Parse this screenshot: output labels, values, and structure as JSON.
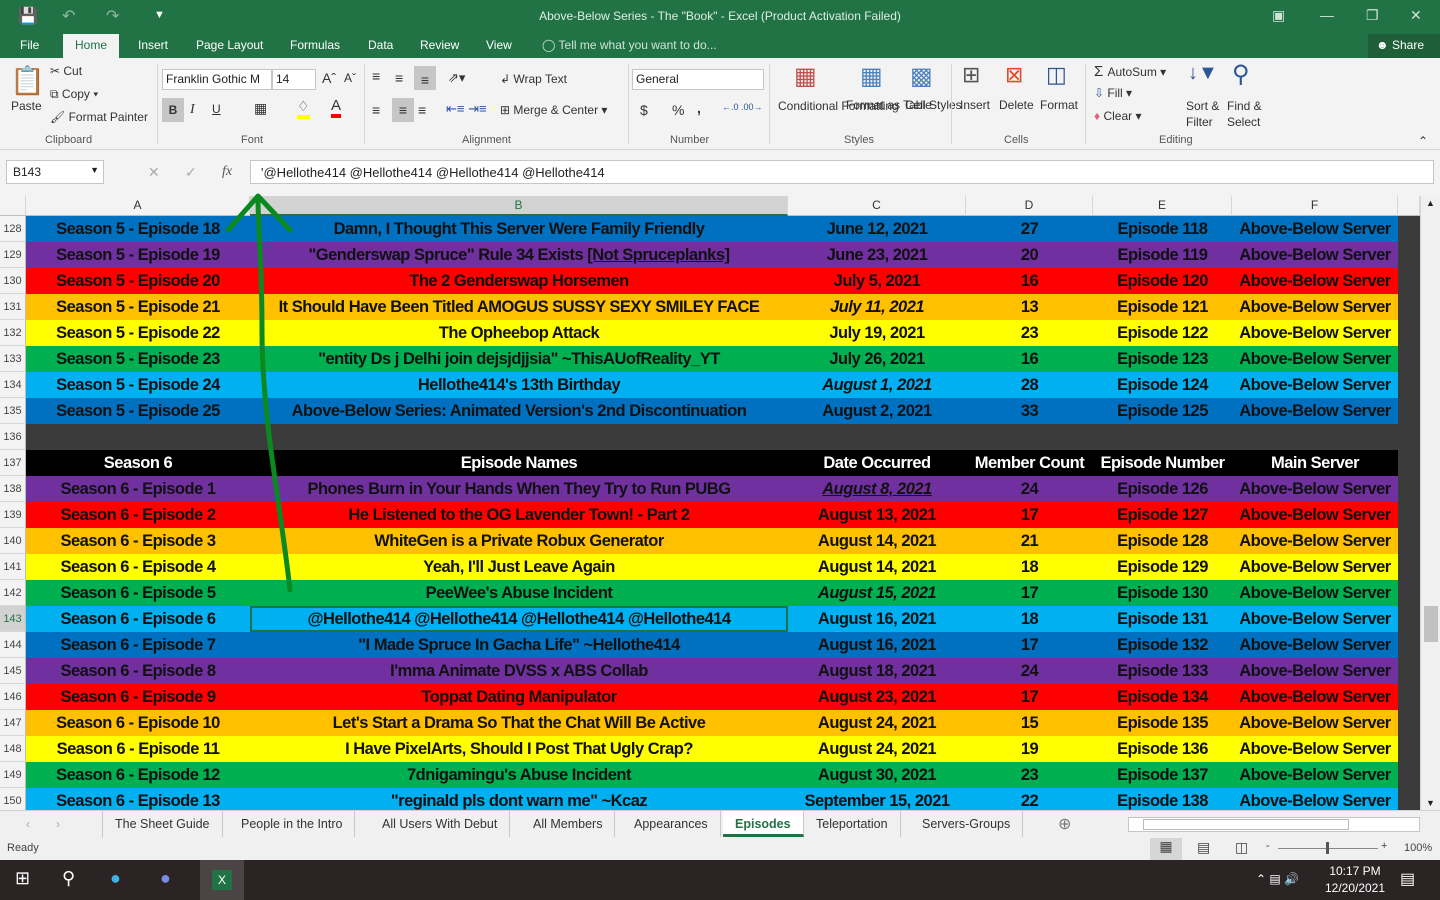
{
  "window": {
    "title": "Above-Below Series - The \"Book\" - Excel (Product Activation Failed)"
  },
  "menu_tabs": [
    "File",
    "Home",
    "Insert",
    "Page Layout",
    "Formulas",
    "Data",
    "Review",
    "View"
  ],
  "active_tab": "Home",
  "tell_me": "Tell me what you want to do...",
  "share": "Share",
  "ribbon": {
    "clipboard": {
      "label": "Clipboard",
      "paste": "Paste",
      "cut": "Cut",
      "copy": "Copy",
      "format_painter": "Format Painter"
    },
    "font": {
      "label": "Font",
      "name": "Franklin Gothic M",
      "size": "14",
      "bold": "B",
      "italic": "I",
      "underline": "U",
      "fill_color": "#FFFF00",
      "font_color": "#FF0000"
    },
    "alignment": {
      "label": "Alignment",
      "wrap_text": "Wrap Text",
      "merge_center": "Merge & Center"
    },
    "number": {
      "label": "Number",
      "format": "General",
      "currency": "$",
      "percent": "%",
      "comma": ","
    },
    "styles": {
      "label": "Styles",
      "conditional": "Conditional Formatting",
      "format_table": "Format as Table",
      "cell_styles": "Cell Styles"
    },
    "cells": {
      "label": "Cells",
      "insert": "Insert",
      "delete": "Delete",
      "format": "Format"
    },
    "editing": {
      "label": "Editing",
      "autosum": "AutoSum",
      "fill": "Fill",
      "clear": "Clear",
      "sort_filter": "Sort & Filter",
      "find_select": "Find & Select"
    }
  },
  "formula_bar": {
    "name_box": "B143",
    "formula": "'@Hellothe414 @Hellothe414 @Hellothe414 @Hellothe414",
    "fx": "fx"
  },
  "columns": [
    "A",
    "B",
    "C",
    "D",
    "E",
    "F"
  ],
  "colors": {
    "dark_blue": "#0070C0",
    "purple": "#7030A0",
    "red": "#FF0000",
    "orange": "#FFC000",
    "yellow": "#FFFF00",
    "green": "#00B050",
    "light_blue": "#00B0F0",
    "header": "#000000",
    "excel_green": "#217346",
    "annotation_arrow": "#0a8a1e"
  },
  "rows": [
    {
      "n": "128",
      "color": "#0070C0",
      "cells": [
        "Season 5 - Episode 18",
        "Damn, I Thought This Server Were Family Friendly",
        "June 12, 2021",
        "27",
        "Episode 118",
        "Above-Below Server"
      ]
    },
    {
      "n": "129",
      "color": "#7030A0",
      "cells": [
        "Season 5 - Episode 19",
        "\"Genderswap Spruce\" Rule 34 Exists ",
        "June 23, 2021",
        "20",
        "Episode 119",
        "Above-Below Server"
      ],
      "b_underlined": "[Not Spruceplanks]"
    },
    {
      "n": "130",
      "color": "#FF0000",
      "cells": [
        "Season 5 - Episode 20",
        "The 2 Genderswap Horsemen",
        "July 5, 2021",
        "16",
        "Episode 120",
        "Above-Below Server"
      ]
    },
    {
      "n": "131",
      "color": "#FFC000",
      "cells": [
        "Season 5 - Episode 21",
        "It Should Have Been Titled AMOGUS SUSSY SEXY SMILEY FACE",
        "July 11, 2021",
        "13",
        "Episode 121",
        "Above-Below Server"
      ],
      "date_style": "italic"
    },
    {
      "n": "132",
      "color": "#FFFF00",
      "cells": [
        "Season 5 - Episode 22",
        "The Opheebop Attack",
        "July 19, 2021",
        "23",
        "Episode 122",
        "Above-Below Server"
      ]
    },
    {
      "n": "133",
      "color": "#00B050",
      "cells": [
        "Season 5 - Episode 23",
        "\"entity Ds j Delhi join dejsjdjjsia\"  ~ThisAUofReality_YT",
        "July 26, 2021",
        "16",
        "Episode 123",
        "Above-Below Server"
      ]
    },
    {
      "n": "134",
      "color": "#00B0F0",
      "cells": [
        "Season 5 - Episode 24",
        "Hellothe414's 13th Birthday",
        "August 1, 2021",
        "28",
        "Episode 124",
        "Above-Below Server"
      ],
      "date_style": "italic"
    },
    {
      "n": "135",
      "color": "#0070C0",
      "cells": [
        "Season 5 - Episode 25",
        "Above-Below Series: Animated Version's 2nd Discontinuation",
        "August 2, 2021",
        "33",
        "Episode 125",
        "Above-Below Server"
      ]
    },
    {
      "n": "136",
      "color": "#3b3b3b",
      "cells": [
        "",
        "",
        "",
        "",
        "",
        ""
      ]
    },
    {
      "n": "137",
      "color": "#000000",
      "header": true,
      "cells": [
        "Season 6",
        "Episode Names",
        "Date Occurred",
        "Member Count",
        "Episode Number",
        "Main Server"
      ]
    },
    {
      "n": "138",
      "color": "#7030A0",
      "cells": [
        "Season 6 - Episode 1",
        "Phones Burn in Your Hands When They Try to Run PUBG",
        "August 8, 2021",
        "24",
        "Episode 126",
        "Above-Below Server"
      ],
      "date_style": "italic-underline"
    },
    {
      "n": "139",
      "color": "#FF0000",
      "cells": [
        "Season 6 - Episode 2",
        "He Listened to the OG Lavender Town! - Part 2",
        "August 13, 2021",
        "17",
        "Episode 127",
        "Above-Below Server"
      ]
    },
    {
      "n": "140",
      "color": "#FFC000",
      "cells": [
        "Season 6 - Episode 3",
        "WhiteGen is a Private Robux Generator",
        "August 14, 2021",
        "21",
        "Episode 128",
        "Above-Below Server"
      ]
    },
    {
      "n": "141",
      "color": "#FFFF00",
      "cells": [
        "Season 6 - Episode 4",
        "Yeah, I'll Just Leave Again",
        "August 14, 2021",
        "18",
        "Episode 129",
        "Above-Below Server"
      ]
    },
    {
      "n": "142",
      "color": "#00B050",
      "cells": [
        "Season 6 - Episode 5",
        "PeeWee's Abuse Incident",
        "August 15, 2021",
        "17",
        "Episode 130",
        "Above-Below Server"
      ],
      "date_style": "italic"
    },
    {
      "n": "143",
      "color": "#00B0F0",
      "selected": true,
      "cells": [
        "Season 6 - Episode 6",
        "@Hellothe414 @Hellothe414 @Hellothe414 @Hellothe414",
        "August 16, 2021",
        "18",
        "Episode 131",
        "Above-Below Server"
      ]
    },
    {
      "n": "144",
      "color": "#0070C0",
      "cells": [
        "Season 6 - Episode 7",
        "\"I Made Spruce In Gacha Life\" ~Hellothe414",
        "August 16, 2021",
        "17",
        "Episode 132",
        "Above-Below Server"
      ]
    },
    {
      "n": "145",
      "color": "#7030A0",
      "cells": [
        "Season 6 - Episode 8",
        "I'mma Animate DVSS x ABS Collab",
        "August 18, 2021",
        "24",
        "Episode 133",
        "Above-Below Server"
      ]
    },
    {
      "n": "146",
      "color": "#FF0000",
      "cells": [
        "Season 6 - Episode 9",
        "Toppat Dating Manipulator",
        "August 23, 2021",
        "17",
        "Episode 134",
        "Above-Below Server"
      ]
    },
    {
      "n": "147",
      "color": "#FFC000",
      "cells": [
        "Season 6 - Episode 10",
        "Let's Start a Drama So That the Chat Will Be Active",
        "August 24, 2021",
        "15",
        "Episode 135",
        "Above-Below Server"
      ]
    },
    {
      "n": "148",
      "color": "#FFFF00",
      "cells": [
        "Season 6 - Episode 11",
        "I Have PixelArts, Should I Post That Ugly Crap?",
        "August 24, 2021",
        "19",
        "Episode 136",
        "Above-Below Server"
      ]
    },
    {
      "n": "149",
      "color": "#00B050",
      "cells": [
        "Season 6 - Episode 12",
        "7dnigamingu's Abuse Incident",
        "August 30, 2021",
        "23",
        "Episode 137",
        "Above-Below Server"
      ]
    },
    {
      "n": "150",
      "color": "#00B0F0",
      "cells": [
        "Season 6 - Episode 13",
        "\"reginald pls dont warn me\" ~Kcaz",
        "September 15, 2021",
        "22",
        "Episode 138",
        "Above-Below Server"
      ]
    }
  ],
  "sheet_tabs": [
    "The Sheet Guide",
    "People in the Intro",
    "All Users With Debut",
    "All Members",
    "Appearances",
    "Episodes",
    "Teleportation",
    "Servers-Groups"
  ],
  "active_sheet": "Episodes",
  "status": {
    "ready": "Ready",
    "zoom": "100%",
    "zoom_level_percent": 100
  },
  "taskbar": {
    "time": "10:17 PM",
    "date": "12/20/2021"
  }
}
